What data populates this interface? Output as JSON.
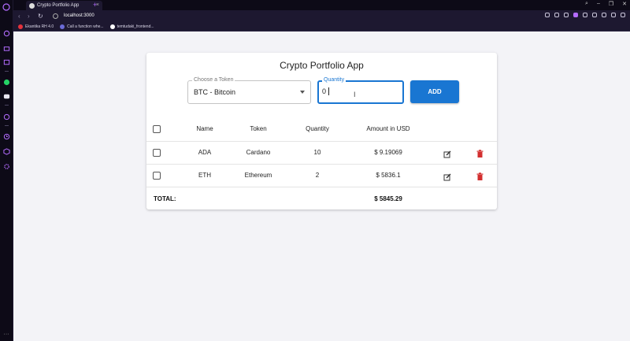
{
  "browser": {
    "tab_title": "Crypto Portfolio App",
    "url": "localhost:3000",
    "bookmarks": [
      {
        "label": "Ekantika RH 4.0",
        "color": "#e4323c"
      },
      {
        "label": "Call a function whe...",
        "color": "#6b6bd6"
      },
      {
        "label": "temtudaki_frontend...",
        "color": "#ffffff"
      }
    ],
    "accent_color": "#b46cff"
  },
  "app": {
    "title": "Crypto Portfolio App",
    "select": {
      "label": "Choose a Token",
      "value": "BTC - Bitcoin"
    },
    "quantity": {
      "label": "Quantity",
      "value": "0"
    },
    "add_label": "ADD",
    "primary_color": "#1976d2",
    "delete_color": "#d32f2f"
  },
  "table": {
    "headers": [
      "Name",
      "Token",
      "Quantity",
      "Amount in USD"
    ],
    "rows": [
      {
        "name": "ADA",
        "token": "Cardano",
        "quantity": "10",
        "amount": "$ 9.19069"
      },
      {
        "name": "ETH",
        "token": "Ethereum",
        "quantity": "2",
        "amount": "$ 5836.1"
      }
    ],
    "total_label": "TOTAL:",
    "total_value": "$ 5845.29"
  }
}
